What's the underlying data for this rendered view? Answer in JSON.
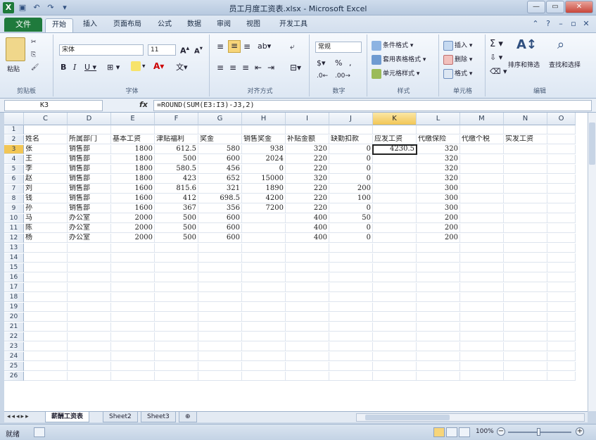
{
  "window": {
    "title": "员工月度工资表.xlsx - Microsoft Excel",
    "controls": [
      "—",
      "▭",
      "✕"
    ]
  },
  "ribbon_tabs": {
    "file": "文件",
    "items": [
      "开始",
      "插入",
      "页面布局",
      "公式",
      "数据",
      "审阅",
      "视图",
      "开发工具"
    ],
    "active": "开始"
  },
  "ribbon": {
    "clipboard": {
      "paste": "粘贴",
      "label": "剪贴板"
    },
    "font": {
      "name": "宋体",
      "size": "11",
      "label": "字体"
    },
    "alignment": {
      "label": "对齐方式"
    },
    "number": {
      "format": "常规",
      "label": "数字"
    },
    "styles": {
      "conditional": "条件格式",
      "table": "套用表格格式",
      "cell": "单元格样式",
      "label": "样式"
    },
    "cells": {
      "insert": "插入",
      "delete": "删除",
      "format": "格式",
      "label": "单元格"
    },
    "editing": {
      "sort": "排序和筛选",
      "find": "查找和选择",
      "label": "编辑"
    }
  },
  "formula_bar": {
    "name_box": "K3",
    "formula": "=ROUND(SUM(E3:I3)-J3,2)"
  },
  "columns": [
    "C",
    "D",
    "E",
    "F",
    "G",
    "H",
    "I",
    "J",
    "K",
    "L",
    "M",
    "N",
    "O"
  ],
  "selected_column": "K",
  "selected_row": 3,
  "row_numbers": [
    "1",
    "2",
    "3",
    "4",
    "5",
    "6",
    "7",
    "8",
    "9",
    "10",
    "11",
    "12",
    "13",
    "14",
    "15",
    "16",
    "17",
    "18",
    "19",
    "20",
    "21",
    "22",
    "23",
    "24",
    "25",
    "26"
  ],
  "headers": [
    "姓名",
    "所属部门",
    "基本工资",
    "津贴福利",
    "奖金",
    "销售奖金",
    "补贴金额",
    "缺勤扣款",
    "应发工资",
    "代缴保险",
    "代缴个税",
    "实发工资"
  ],
  "rows": [
    [
      "张",
      "销售部",
      "1800",
      "612.5",
      "580",
      "938",
      "320",
      "0",
      "4230.5",
      "320"
    ],
    [
      "王",
      "销售部",
      "1800",
      "500",
      "600",
      "2024",
      "220",
      "0",
      "",
      "320"
    ],
    [
      "李",
      "销售部",
      "1800",
      "580.5",
      "456",
      "0",
      "220",
      "0",
      "",
      "320"
    ],
    [
      "赵",
      "销售部",
      "1800",
      "423",
      "652",
      "15000",
      "320",
      "0",
      "",
      "320"
    ],
    [
      "刘",
      "销售部",
      "1600",
      "815.6",
      "321",
      "1890",
      "220",
      "200",
      "",
      "300"
    ],
    [
      "钱",
      "销售部",
      "1600",
      "412",
      "698.5",
      "4200",
      "220",
      "100",
      "",
      "300"
    ],
    [
      "孙",
      "销售部",
      "1600",
      "367",
      "356",
      "7200",
      "220",
      "0",
      "",
      "300"
    ],
    [
      "马",
      "办公室",
      "2000",
      "500",
      "600",
      "",
      "400",
      "50",
      "",
      "200"
    ],
    [
      "陈",
      "办公室",
      "2000",
      "500",
      "600",
      "",
      "400",
      "0",
      "",
      "200"
    ],
    [
      "杨",
      "办公室",
      "2000",
      "500",
      "600",
      "",
      "400",
      "0",
      "",
      "200"
    ]
  ],
  "sheets": [
    "薪酬工资表",
    "Sheet2",
    "Sheet3"
  ],
  "active_sheet": "薪酬工资表",
  "status": {
    "ready": "就绪",
    "zoom": "100%"
  }
}
